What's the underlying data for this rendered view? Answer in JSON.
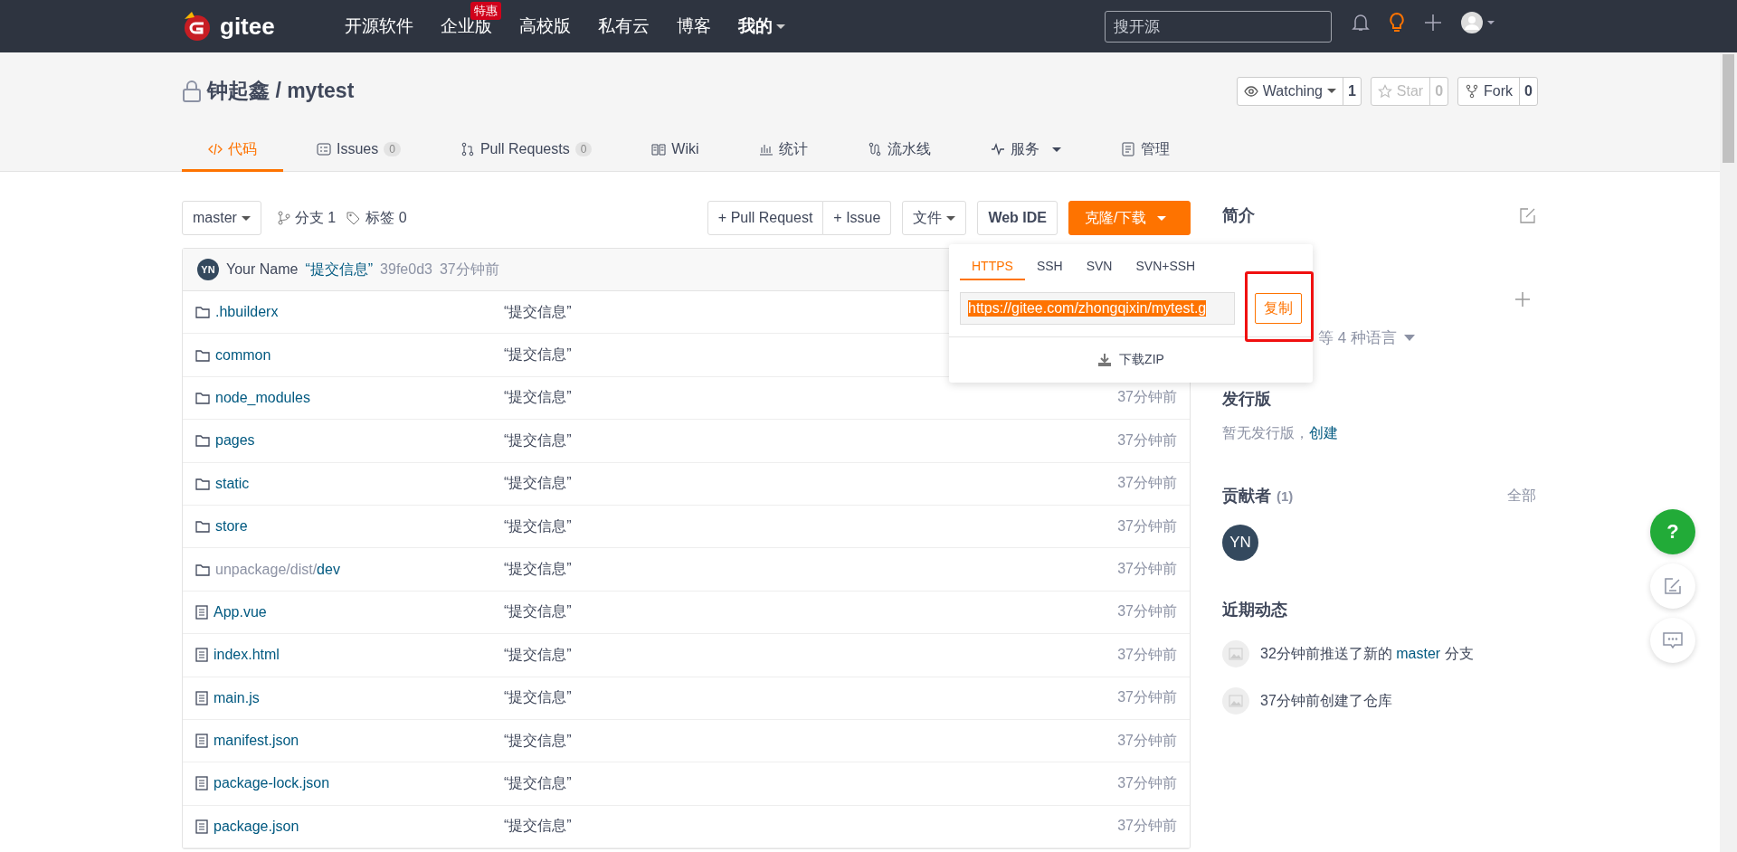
{
  "topnav": {
    "logo": "gitee",
    "items": [
      {
        "label": "开源软件",
        "dropdown": false
      },
      {
        "label": "企业版",
        "badge": "特惠",
        "dropdown": false
      },
      {
        "label": "高校版",
        "dropdown": false
      },
      {
        "label": "私有云",
        "dropdown": false
      },
      {
        "label": "博客",
        "dropdown": false
      },
      {
        "label": "我的",
        "dropdown": true
      }
    ],
    "search": {
      "placeholder": "搜开源"
    }
  },
  "repo": {
    "title": "钟起鑫 / mytest",
    "actions": [
      {
        "label": "Watching",
        "count": "1",
        "dropdown": true,
        "disabled": false
      },
      {
        "label": "Star",
        "count": "0",
        "dropdown": false,
        "disabled": true
      },
      {
        "label": "Fork",
        "count": "0",
        "dropdown": false,
        "disabled": false
      }
    ]
  },
  "tabs": [
    {
      "label": "代码",
      "selected": true
    },
    {
      "label": "Issues",
      "count": "0",
      "selected": false
    },
    {
      "label": "Pull Requests",
      "count": "0",
      "selected": false
    },
    {
      "label": "Wiki",
      "selected": false
    },
    {
      "label": "统计",
      "selected": false
    },
    {
      "label": "流水线",
      "selected": false
    },
    {
      "label": "服务",
      "dropdown": true,
      "selected": false
    },
    {
      "label": "管理",
      "selected": false
    }
  ],
  "toolbar": {
    "branch": "master",
    "branches": "分支 1",
    "tags": "标签 0",
    "new_buttons": [
      "+ Pull Request",
      "+ Issue"
    ],
    "file_button": "文件",
    "ide_button": "Web IDE",
    "clone_button": "克隆/下载"
  },
  "commit": {
    "avatar": "YN",
    "author": "Your Name",
    "message": "“提交信息”",
    "hash": "39fe0d3",
    "time": "37分钟前"
  },
  "files": [
    {
      "kind": "folder",
      "name": ".hbuilderx",
      "message": "“提交信息”"
    },
    {
      "kind": "folder",
      "name": "common",
      "message": "“提交信息”"
    },
    {
      "kind": "folder",
      "name": "node_modules",
      "message": "“提交信息”",
      "time": "37分钟前"
    },
    {
      "kind": "folder",
      "name": "pages",
      "message": "“提交信息”",
      "time": "37分钟前"
    },
    {
      "kind": "folder",
      "name": "static",
      "message": "“提交信息”",
      "time": "37分钟前"
    },
    {
      "kind": "folder",
      "name": "store",
      "message": "“提交信息”",
      "time": "37分钟前"
    },
    {
      "kind": "folder",
      "prefix": "unpackage/dist/",
      "name": "dev",
      "message": "“提交信息”",
      "time": "37分钟前"
    },
    {
      "kind": "file",
      "name": "App.vue",
      "message": "“提交信息”",
      "time": "37分钟前"
    },
    {
      "kind": "file",
      "name": "index.html",
      "message": "“提交信息”",
      "time": "37分钟前"
    },
    {
      "kind": "file",
      "name": "main.js",
      "message": "“提交信息”",
      "time": "37分钟前"
    },
    {
      "kind": "file",
      "name": "manifest.json",
      "message": "“提交信息”",
      "time": "37分钟前"
    },
    {
      "kind": "file",
      "name": "package-lock.json",
      "message": "“提交信息”",
      "time": "37分钟前"
    },
    {
      "kind": "file",
      "name": "package.json",
      "message": "“提交信息”",
      "time": "37分钟前"
    }
  ],
  "clone_dropdown": {
    "tabs": [
      {
        "label": "HTTPS",
        "selected": true
      },
      {
        "label": "SSH",
        "selected": false
      },
      {
        "label": "SVN",
        "selected": false
      },
      {
        "label": "SVN+SSH",
        "selected": false
      }
    ],
    "url": "https://gitee.com/zhongqixin/mytest.g",
    "copy_button": "复制",
    "highlighted": true,
    "download": "下载ZIP"
  },
  "sidebar": {
    "intro_heading": "简介",
    "languages": "等 4 种语言",
    "releases_heading": "发行版",
    "releases_text": "暂无发行版，",
    "releases_link": "创建",
    "contributors_heading": "贡献者",
    "contributors_count": "(1)",
    "contributors_all": "全部",
    "contributors": [
      "YN"
    ],
    "activity_heading": "近期动态",
    "activity": [
      {
        "before": "32分钟前推送了新的 ",
        "link": "master",
        "after": " 分支"
      },
      {
        "before": "37分钟前创建了仓库"
      }
    ]
  },
  "float_buttons": {
    "help": "?"
  }
}
